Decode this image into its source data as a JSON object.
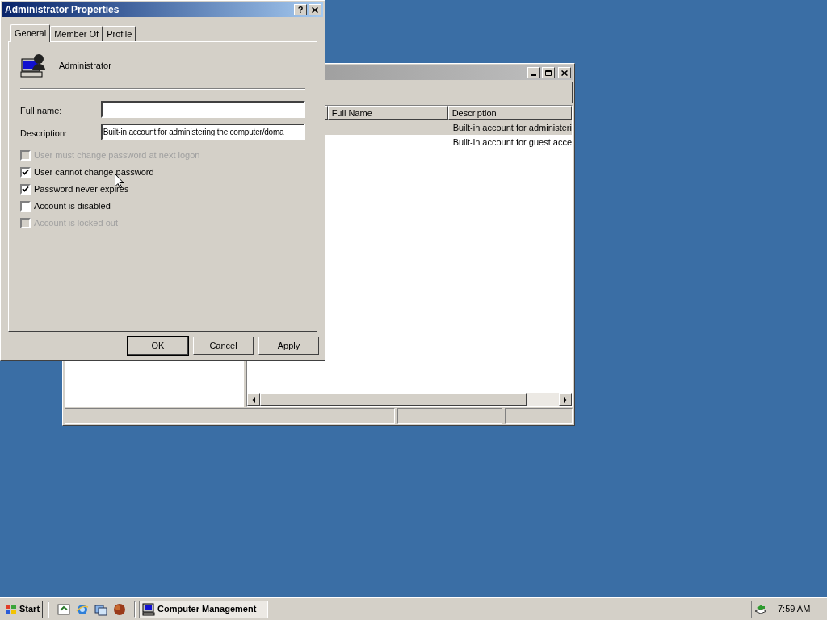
{
  "background_window": {
    "columns": [
      "Full Name",
      "Description"
    ],
    "rows": [
      {
        "description": "Built-in account for administeri",
        "selected": true
      },
      {
        "description": "Built-in account for guest acce",
        "selected": false
      }
    ]
  },
  "dialog": {
    "title": "Administrator Properties",
    "help": "?",
    "tabs": [
      {
        "label": "General",
        "selected": true
      },
      {
        "label": "Member Of",
        "selected": false
      },
      {
        "label": "Profile",
        "selected": false
      }
    ],
    "user_name": "Administrator",
    "fields": [
      {
        "label": "Full name:"
      },
      {
        "label": "Description:",
        "value": "Built-in account for administering the computer/doma"
      }
    ],
    "checkboxes": [
      {
        "label": "User must change password at next logon",
        "checked": false,
        "disabled": true
      },
      {
        "label": "User cannot change password",
        "checked": true,
        "disabled": false
      },
      {
        "label": "Password never expires",
        "checked": true,
        "disabled": false
      },
      {
        "label": "Account is disabled",
        "checked": false,
        "disabled": false
      },
      {
        "label": "Account is locked out",
        "checked": false,
        "disabled": true
      }
    ],
    "buttons": [
      {
        "label": "OK",
        "default": true
      },
      {
        "label": "Cancel",
        "default": false
      },
      {
        "label": "Apply",
        "default": false
      }
    ]
  },
  "taskbar": {
    "start": "Start",
    "tasks": [
      {
        "label": "Computer Management",
        "selected": true
      }
    ],
    "time": "7:59 AM"
  }
}
